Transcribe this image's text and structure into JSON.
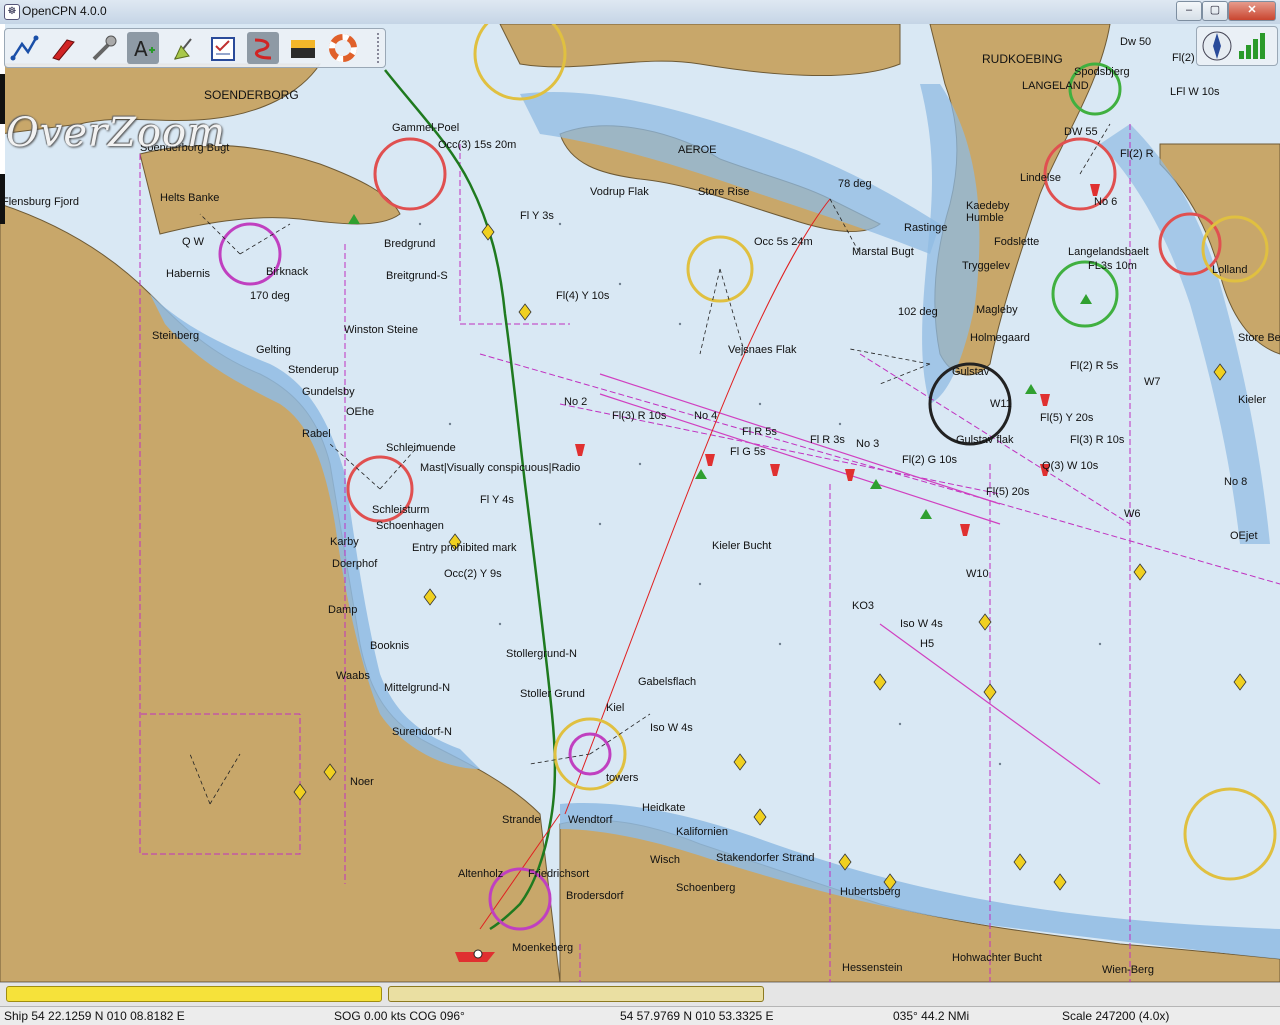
{
  "window": {
    "title": "OpenCPN 4.0.0",
    "app_icon": "opencpn-icon",
    "controls": {
      "minimize": "–",
      "maximize": "▢",
      "close": "✕"
    }
  },
  "toolbar": {
    "tools": [
      {
        "name": "route-icon"
      },
      {
        "name": "ship-icon"
      },
      {
        "name": "settings-icon"
      },
      {
        "name": "text-icon",
        "active": true
      },
      {
        "name": "mark-icon"
      },
      {
        "name": "route-manager-icon"
      },
      {
        "name": "track-icon",
        "active": true
      },
      {
        "name": "tide-icon"
      },
      {
        "name": "mob-icon"
      }
    ]
  },
  "overlay": {
    "overzoom": "OverZoom"
  },
  "map_labels": [
    {
      "id": "soenderborg",
      "text": "SOENDERBORG"
    },
    {
      "id": "rudkoebing",
      "text": "RUDKOEBING"
    },
    {
      "id": "langeland",
      "text": "LANGELAND"
    },
    {
      "id": "aeroe",
      "text": "AEROE"
    },
    {
      "id": "gammel_poel",
      "text": "Gammel-Poel"
    },
    {
      "id": "occ3",
      "text": "Occ(3) 15s 20m"
    },
    {
      "id": "helts_banke",
      "text": "Helts Banke"
    },
    {
      "id": "vodrup_flak",
      "text": "Vodrup Flak"
    },
    {
      "id": "store_rise",
      "text": "Store Rise"
    },
    {
      "id": "flensburg",
      "text": "Flensburg Fjord"
    },
    {
      "id": "soenderborg_bugt",
      "text": "Soenderborg Bugt"
    },
    {
      "id": "fly3s",
      "text": "Fl Y 3s"
    },
    {
      "id": "bredgrund",
      "text": "Bredgrund"
    },
    {
      "id": "breitgrund",
      "text": "Breitgrund-S"
    },
    {
      "id": "habernis",
      "text": "Habernis"
    },
    {
      "id": "birknack",
      "text": "Birknack"
    },
    {
      "id": "fl4y10s",
      "text": "Fl(4) Y 10s"
    },
    {
      "id": "occ5s",
      "text": "Occ 5s 24m"
    },
    {
      "id": "marstal",
      "text": "Marstal Bugt"
    },
    {
      "id": "rastinge",
      "text": "Rastinge"
    },
    {
      "id": "kaedeby",
      "text": "Kaedeby Humble"
    },
    {
      "id": "lindelse",
      "text": "Lindelse"
    },
    {
      "id": "fodslette",
      "text": "Fodslette"
    },
    {
      "id": "tryggelev",
      "text": "Tryggelev"
    },
    {
      "id": "steinberg",
      "text": "Steinberg"
    },
    {
      "id": "gelting",
      "text": "Gelting"
    },
    {
      "id": "winston",
      "text": "Winston Steine"
    },
    {
      "id": "vejsnaes",
      "text": "Vejsnaes Flak"
    },
    {
      "id": "magleby",
      "text": "Magleby"
    },
    {
      "id": "holmegaard",
      "text": "Holmegaard"
    },
    {
      "id": "stenderup",
      "text": "Stenderup"
    },
    {
      "id": "gundelsby",
      "text": "Gundelsby"
    },
    {
      "id": "oehe",
      "text": "OEhe"
    },
    {
      "id": "no2",
      "text": "No 2"
    },
    {
      "id": "fl3r10s",
      "text": "Fl(3) R 10s"
    },
    {
      "id": "no4",
      "text": "No 4"
    },
    {
      "id": "flr5s",
      "text": "Fl R 5s"
    },
    {
      "id": "flr3s",
      "text": "Fl R 3s"
    },
    {
      "id": "no3",
      "text": "No 3"
    },
    {
      "id": "gulstav",
      "text": "Gulstav flak"
    },
    {
      "id": "rabel",
      "text": "Rabel"
    },
    {
      "id": "schleimuende",
      "text": "Schleimuende"
    },
    {
      "id": "mast",
      "text": "Mast|Visually conspicuous|Radio"
    },
    {
      "id": "flg5s",
      "text": "Fl G 5s"
    },
    {
      "id": "fl2g10s",
      "text": "Fl(2) G 10s"
    },
    {
      "id": "fl5y20s",
      "text": "Fl(5) Y 20s"
    },
    {
      "id": "fl3r10s_b",
      "text": "Fl(3) R 10s"
    },
    {
      "id": "q3w10s",
      "text": "Q(3) W 10s"
    },
    {
      "id": "fly4s",
      "text": "Fl Y 4s"
    },
    {
      "id": "schleisturm",
      "text": "Schleisturm"
    },
    {
      "id": "schoenhagen",
      "text": "Schoenhagen"
    },
    {
      "id": "entry",
      "text": "Entry prohibited mark"
    },
    {
      "id": "kieler_bucht",
      "text": "Kieler Bucht"
    },
    {
      "id": "karby",
      "text": "Karby"
    },
    {
      "id": "doerphof",
      "text": "Doerphof"
    },
    {
      "id": "occ2y9s",
      "text": "Occ(2) Y 9s"
    },
    {
      "id": "damp",
      "text": "Damp"
    },
    {
      "id": "ko3",
      "text": "KO3"
    },
    {
      "id": "isow4s",
      "text": "Iso W 4s"
    },
    {
      "id": "h5",
      "text": "H5"
    },
    {
      "id": "stollergrund_n",
      "text": "Stollergrund-N"
    },
    {
      "id": "stoller_grund",
      "text": "Stoller Grund"
    },
    {
      "id": "gabelsflach",
      "text": "Gabelsflach"
    },
    {
      "id": "booknis",
      "text": "Booknis"
    },
    {
      "id": "mittelgrund",
      "text": "Mittelgrund-N"
    },
    {
      "id": "waabs",
      "text": "Waabs"
    },
    {
      "id": "kiel",
      "text": "Kiel"
    },
    {
      "id": "iso_w4s_b",
      "text": "Iso W 4s"
    },
    {
      "id": "surendorf",
      "text": "Surendorf-N"
    },
    {
      "id": "noer",
      "text": "Noer"
    },
    {
      "id": "towers",
      "text": "towers"
    },
    {
      "id": "heidkate",
      "text": "Heidkate"
    },
    {
      "id": "kalifornien",
      "text": "Kalifornien"
    },
    {
      "id": "wendtorf",
      "text": "Wendtorf"
    },
    {
      "id": "strande",
      "text": "Strande"
    },
    {
      "id": "stakendorfer",
      "text": "Stakendorfer Strand"
    },
    {
      "id": "wisch",
      "text": "Wisch"
    },
    {
      "id": "schoenberg",
      "text": "Schoenberg"
    },
    {
      "id": "altenholz",
      "text": "Altenholz"
    },
    {
      "id": "friedrichsort",
      "text": "Friedrichsort"
    },
    {
      "id": "brodersdorf",
      "text": "Brodersdorf"
    },
    {
      "id": "moenkeberg",
      "text": "Moenkeberg"
    },
    {
      "id": "hubertsberg",
      "text": "Hubertsberg"
    },
    {
      "id": "hessenstein",
      "text": "Hessenstein"
    },
    {
      "id": "hohwachter",
      "text": "Hohwachter Bucht"
    },
    {
      "id": "wienberg",
      "text": "Wien-Berg"
    },
    {
      "id": "lolland",
      "text": "Lolland"
    },
    {
      "id": "langelandsbaelt",
      "text": "Langelandsbaelt"
    },
    {
      "id": "fl3s",
      "text": "FL3s 10m"
    },
    {
      "id": "no6",
      "text": "No 6"
    },
    {
      "id": "fl2r5s",
      "text": "Fl(2) R 5s"
    },
    {
      "id": "dw50",
      "text": "Dw 50"
    },
    {
      "id": "dw55",
      "text": "DW 55"
    },
    {
      "id": "spodsbjerg",
      "text": "Spodsbjerg"
    },
    {
      "id": "flw10s",
      "text": "LFl W 10s"
    },
    {
      "id": "store_bel",
      "text": "Store Bel"
    },
    {
      "id": "kieler",
      "text": "Kieler"
    },
    {
      "id": "oejet",
      "text": "OEjet"
    },
    {
      "id": "no8",
      "text": "No 8"
    },
    {
      "id": "fl2",
      "text": "Fl(2)"
    },
    {
      "id": "fl2r",
      "text": "Fl(2) R"
    },
    {
      "id": "w11",
      "text": "W11"
    },
    {
      "id": "w7",
      "text": "W7"
    },
    {
      "id": "w6",
      "text": "W6"
    },
    {
      "id": "w10",
      "text": "W10"
    },
    {
      "id": "fl5_20s",
      "text": "Fl(5) 20s"
    },
    {
      "id": "gulstav2",
      "text": "Gulstav"
    },
    {
      "id": "dejg",
      "text": "102 deg"
    },
    {
      "id": "deg78",
      "text": "78 deg"
    },
    {
      "id": "deg170",
      "text": "170 deg"
    },
    {
      "id": "qw",
      "text": "Q W"
    }
  ],
  "status": {
    "ship": "Ship 54 22.1259 N   010 08.8182 E",
    "sog": "SOG 0.00 kts   COG 096°",
    "cursor": "54 57.9769 N   010 53.3325 E",
    "bearing": "035°   44.2 NMi",
    "scale": "Scale 247200 (4.0x)"
  },
  "colors": {
    "land": "#c8a76a",
    "shallow": "#8fbbe3",
    "sea": "#d9e8f4",
    "track": "#1f7a1f",
    "route": "#e02020",
    "boundary": "#c030c0"
  }
}
